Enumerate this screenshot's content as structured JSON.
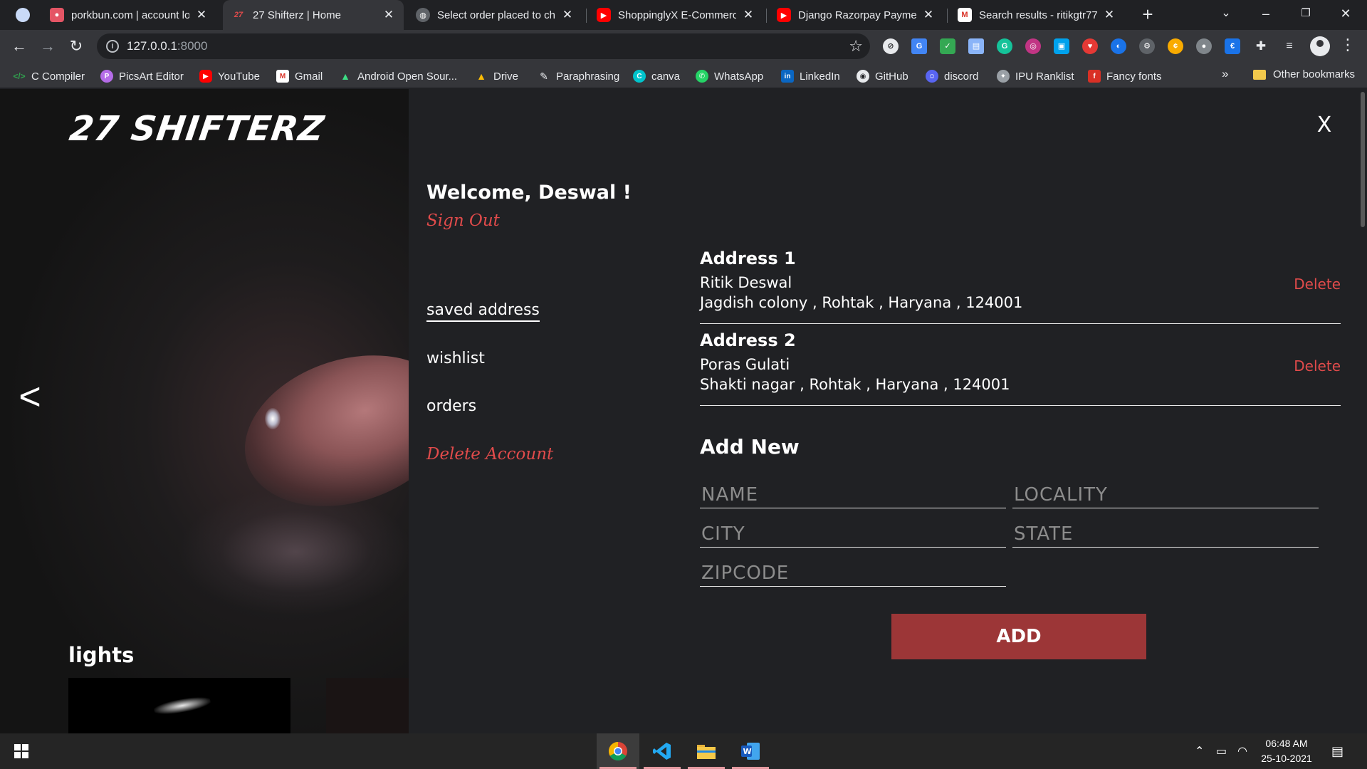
{
  "browser": {
    "tabs": [
      {
        "title": "porkbun.com | account lo",
        "favicon_color": "#e45565",
        "favicon_glyph": "pig",
        "active": false
      },
      {
        "title": "27 Shifterz | Home",
        "favicon_color": "#35363a",
        "favicon_glyph": "27",
        "active": true
      },
      {
        "title": "Select order placed to cha",
        "favicon_color": "#5f6368",
        "favicon_glyph": "globe",
        "active": false
      },
      {
        "title": "ShoppinglyX E-Commerce",
        "favicon_color": "#ff0000",
        "favicon_glyph": "youtube",
        "active": false
      },
      {
        "title": "Django Razorpay Payment",
        "favicon_color": "#ff0000",
        "favicon_glyph": "youtube",
        "active": false
      },
      {
        "title": "Search results - ritikgtr77",
        "favicon_color": "#ffffff",
        "favicon_glyph": "gmail",
        "active": false
      }
    ],
    "tab_close_glyph": "✕",
    "new_tab_glyph": "+",
    "url_host": "127.0.0.1",
    "url_port": ":8000",
    "bookmarks": [
      {
        "label": "C Compiler",
        "icon": "code-icon",
        "color": "#30a14e"
      },
      {
        "label": "PicsArt Editor",
        "icon": "picsart-icon",
        "color": "#b56ce8"
      },
      {
        "label": "YouTube",
        "icon": "youtube-icon",
        "color": "#ff0000"
      },
      {
        "label": "Gmail",
        "icon": "gmail-icon",
        "color": "#ffffff"
      },
      {
        "label": "Android Open Sour...",
        "icon": "android-icon",
        "color": "#3ddc84"
      },
      {
        "label": "Drive",
        "icon": "drive-icon",
        "color": "#fbbc04"
      },
      {
        "label": "Paraphrasing",
        "icon": "quill-icon",
        "color": "#e8eaed"
      },
      {
        "label": "canva",
        "icon": "canva-icon",
        "color": "#00c4cc"
      },
      {
        "label": "WhatsApp",
        "icon": "whatsapp-icon",
        "color": "#25d366"
      },
      {
        "label": "LinkedIn",
        "icon": "linkedin-icon",
        "color": "#0a66c2"
      },
      {
        "label": "GitHub",
        "icon": "github-icon",
        "color": "#e8eaed"
      },
      {
        "label": "discord",
        "icon": "discord-icon",
        "color": "#5865f2"
      },
      {
        "label": "IPU Ranklist",
        "icon": "ipu-icon",
        "color": "#9aa0a6"
      },
      {
        "label": "Fancy fonts",
        "icon": "fancy-fonts-icon",
        "color": "#d93025"
      }
    ],
    "bookmarks_overflow": "»",
    "other_bookmarks": "Other bookmarks"
  },
  "page": {
    "brand": "27 SHIFTERZ",
    "prev_glyph": "<",
    "section_heading": "lights",
    "close_glyph": "X",
    "welcome": "Welcome, Deswal !",
    "sign_out": "Sign Out",
    "menu": [
      {
        "label": "saved address",
        "selected": true
      },
      {
        "label": "wishlist",
        "selected": false
      },
      {
        "label": "orders",
        "selected": false
      }
    ],
    "delete_account": "Delete Account",
    "addresses": [
      {
        "title": "Address 1",
        "name": "Ritik Deswal",
        "line": "Jagdish colony , Rohtak , Haryana , 124001",
        "delete_label": "Delete"
      },
      {
        "title": "Address 2",
        "name": "Poras Gulati",
        "line": "Shakti nagar , Rohtak , Haryana , 124001",
        "delete_label": "Delete"
      }
    ],
    "add_new": {
      "heading": "Add New",
      "fields": {
        "name": "NAME",
        "locality": "LOCALITY",
        "city": "CITY",
        "state": "STATE",
        "zipcode": "ZIPCODE"
      },
      "button": "ADD"
    },
    "accent_color": "#e14b4b",
    "button_color": "#9c3637"
  },
  "taskbar": {
    "apps": [
      "chrome-icon",
      "vscode-icon",
      "file-explorer-icon",
      "word-icon"
    ],
    "time": "06:48 AM",
    "date": "25-10-2021"
  }
}
